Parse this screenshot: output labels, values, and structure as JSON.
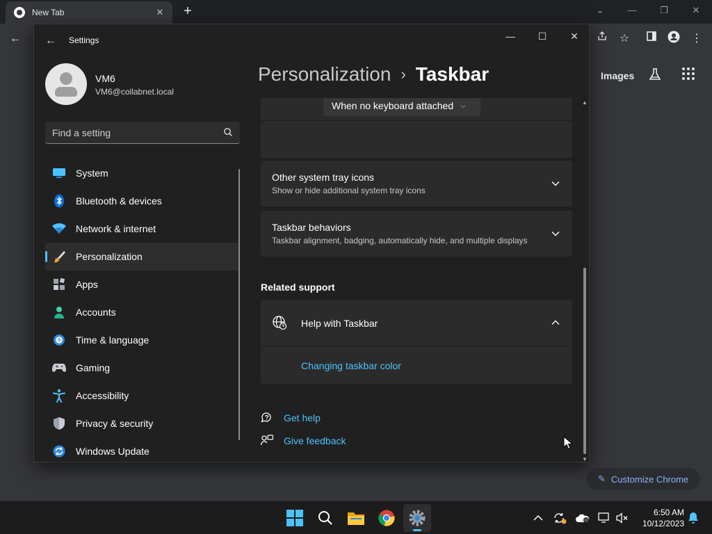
{
  "chrome": {
    "tab_title": "New Tab",
    "tab_close": "✕",
    "new_tab": "+",
    "images_link": "Images",
    "customize_label": "Customize Chrome"
  },
  "settings": {
    "window_title": "Settings",
    "profile": {
      "name": "VM6",
      "email": "VM6@collabnet.local"
    },
    "search": {
      "placeholder": "Find a setting"
    },
    "nav": [
      {
        "label": "System",
        "icon": "monitor-icon"
      },
      {
        "label": "Bluetooth & devices",
        "icon": "bluetooth-icon"
      },
      {
        "label": "Network & internet",
        "icon": "wifi-icon"
      },
      {
        "label": "Personalization",
        "icon": "paintbrush-icon",
        "active": true
      },
      {
        "label": "Apps",
        "icon": "apps-icon"
      },
      {
        "label": "Accounts",
        "icon": "person-icon"
      },
      {
        "label": "Time & language",
        "icon": "globe-clock-icon"
      },
      {
        "label": "Gaming",
        "icon": "gamepad-icon"
      },
      {
        "label": "Accessibility",
        "icon": "accessibility-icon"
      },
      {
        "label": "Privacy & security",
        "icon": "shield-icon"
      },
      {
        "label": "Windows Update",
        "icon": "update-icon"
      }
    ],
    "breadcrumb": {
      "parent": "Personalization",
      "separator": "›",
      "current": "Taskbar"
    },
    "keyboard_dropdown": "When no keyboard attached",
    "cards": {
      "tray": {
        "title": "Other system tray icons",
        "subtitle": "Show or hide additional system tray icons"
      },
      "behaviors": {
        "title": "Taskbar behaviors",
        "subtitle": "Taskbar alignment, badging, automatically hide, and multiple displays"
      }
    },
    "related_support": {
      "heading": "Related support",
      "help_title": "Help with Taskbar",
      "link": "Changing taskbar color"
    },
    "footer": {
      "get_help": "Get help",
      "give_feedback": "Give feedback"
    }
  },
  "taskbar": {
    "time": "6:50 AM",
    "date": "10/12/2023"
  },
  "colors": {
    "accent": "#4cc2ff",
    "window_bg": "#202020",
    "card_bg": "#2b2b2b",
    "chrome_link": "#8ab4f8"
  }
}
